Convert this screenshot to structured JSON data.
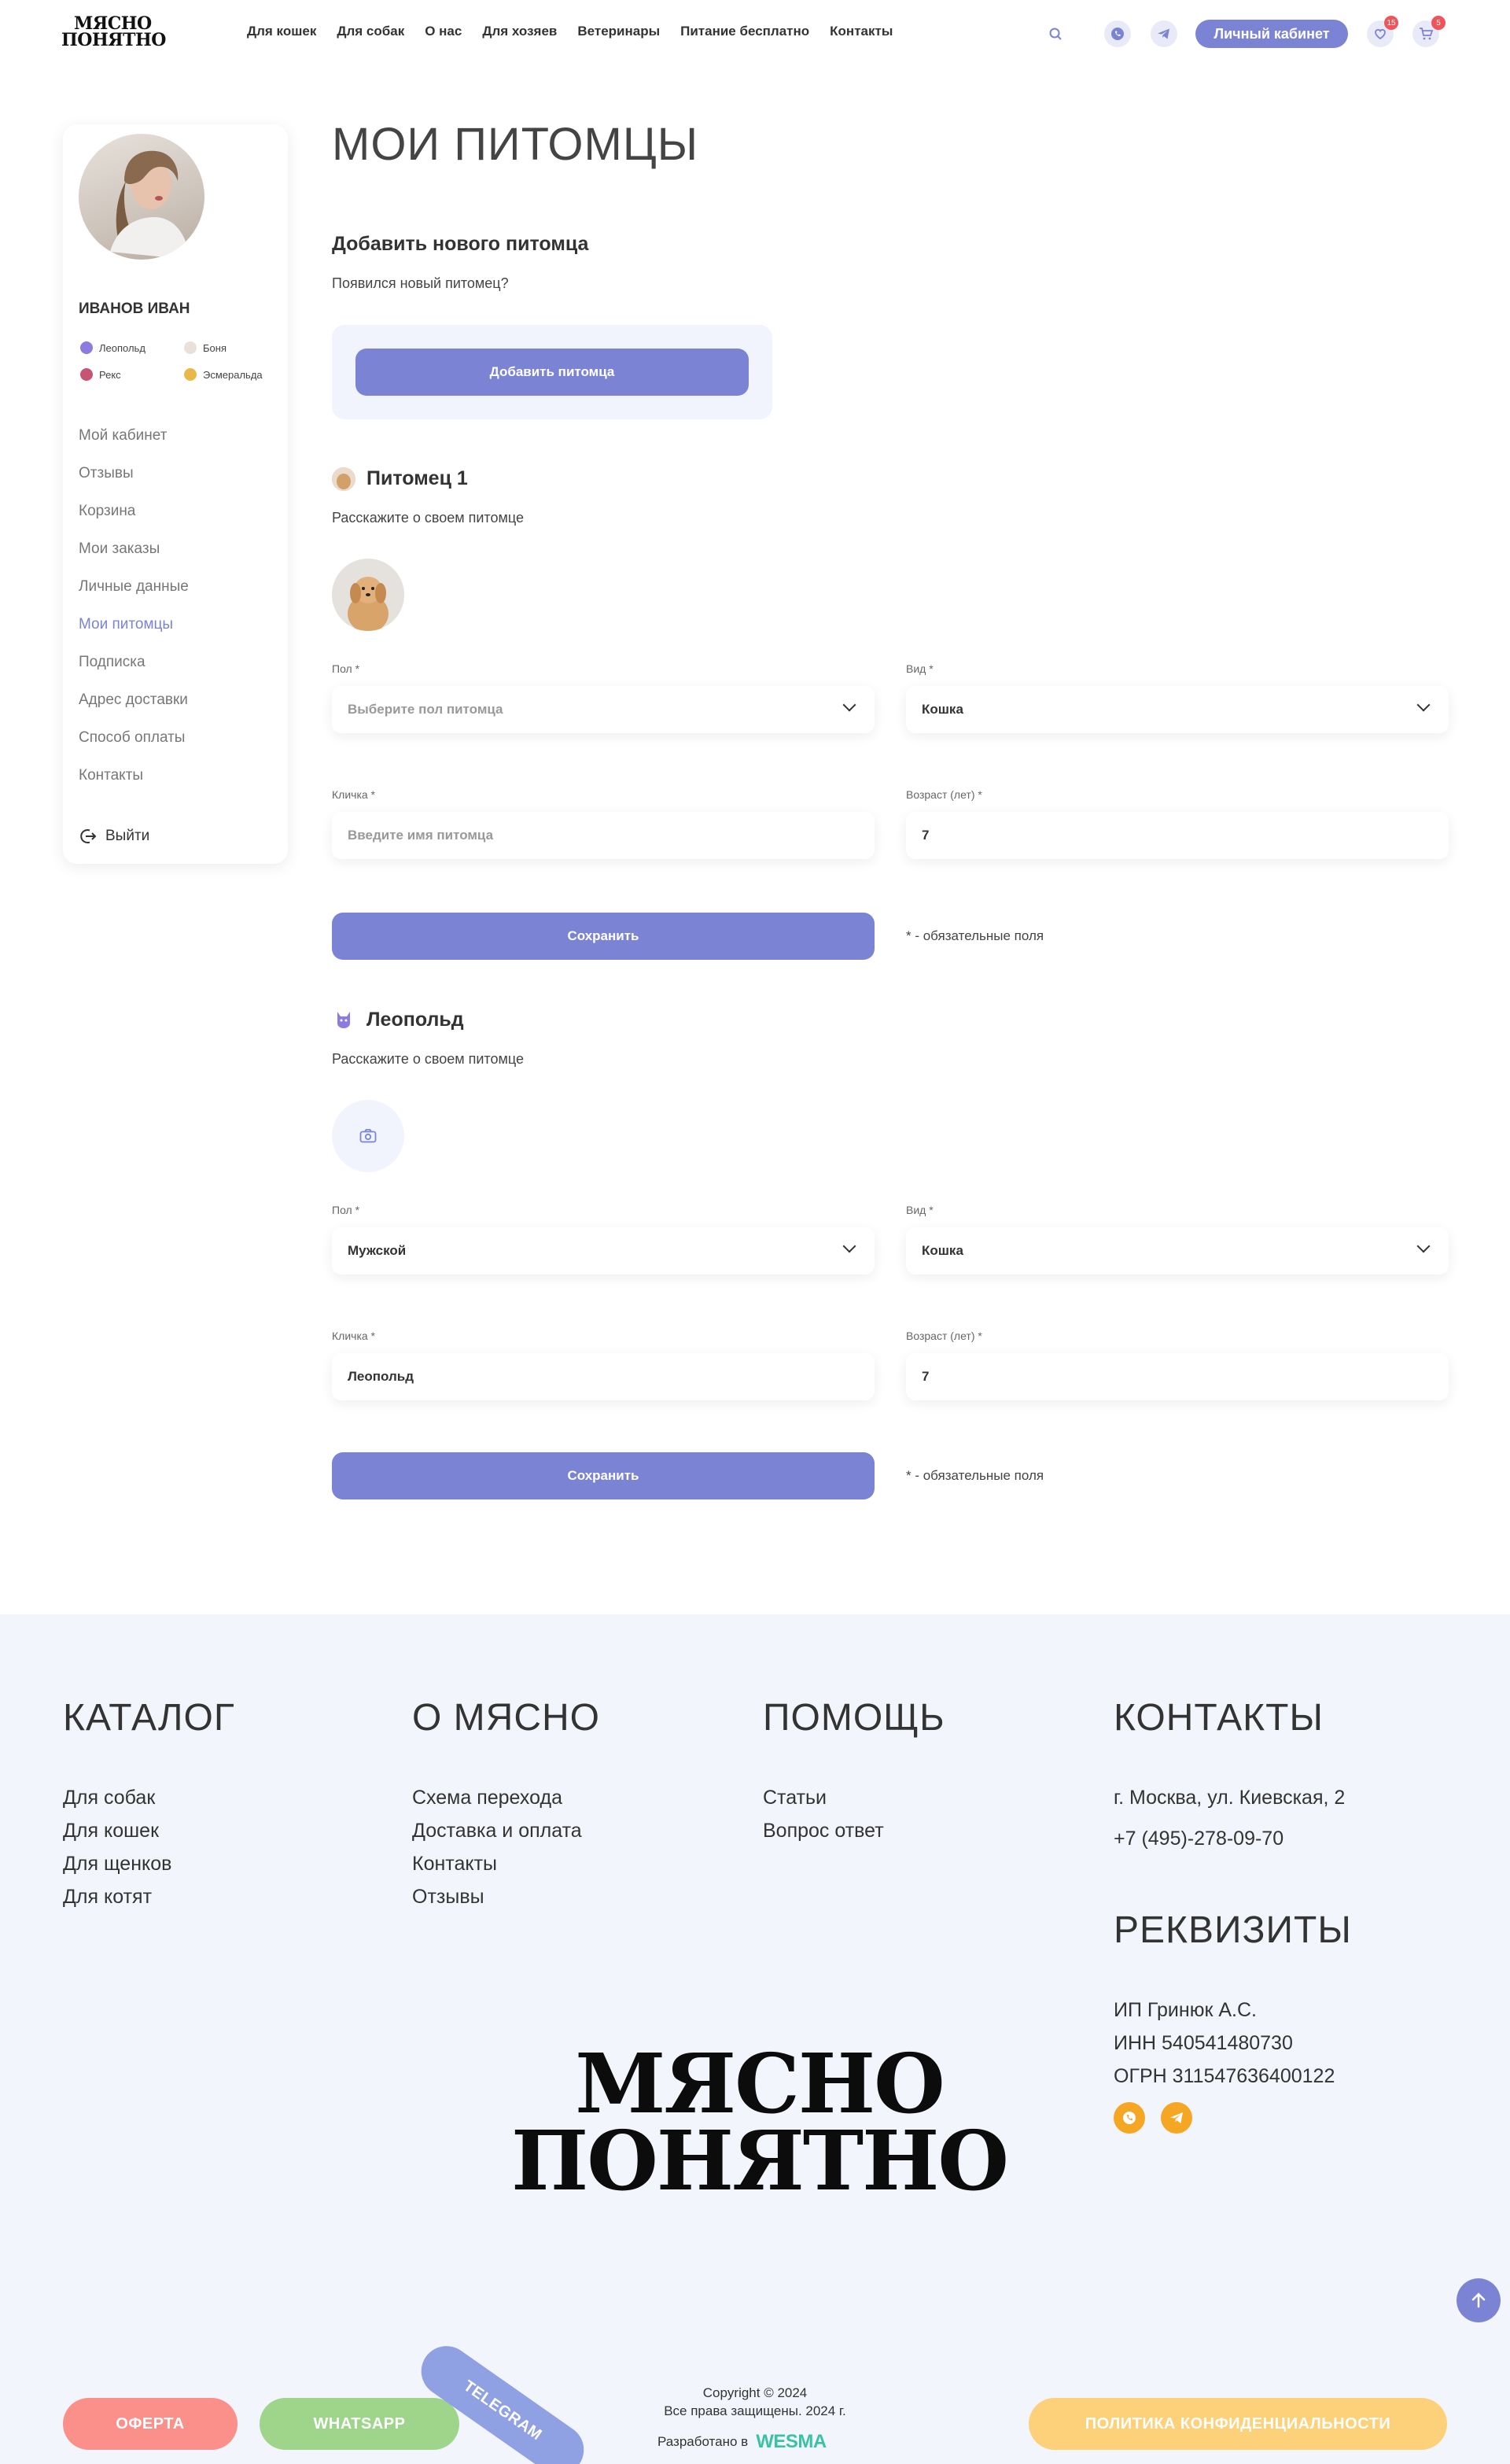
{
  "header": {
    "logo_line1": "МЯСНО",
    "logo_line2": "ПОНЯТНО",
    "nav": [
      "Для кошек",
      "Для собак",
      "О нас",
      "Для хозяев",
      "Ветеринары",
      "Питание бесплатно",
      "Контакты"
    ],
    "cabinet_label": "Личный кабинет",
    "favorites_count": "15",
    "cart_count": "5"
  },
  "sidebar": {
    "user_name": "ИВАНОВ ИВАН",
    "pets": [
      "Леопольд",
      "Боня",
      "Рекс",
      "Эсмеральда"
    ],
    "menu": [
      "Мой кабинет",
      "Отзывы",
      "Корзина",
      "Мои заказы",
      "Личные данные",
      "Мои питомцы",
      "Подписка",
      "Адрес доставки",
      "Способ оплаты",
      "Контакты"
    ],
    "active_item": "Мои питомцы",
    "logout": "Выйти"
  },
  "main": {
    "title": "МОИ ПИТОМЦЫ",
    "add_section": {
      "heading": "Добавить нового питомца",
      "subtitle": "Появился новый питомец?",
      "button": "Добавить питомца"
    },
    "pets": [
      {
        "heading": "Питомец 1",
        "subtitle": "Расскажите о своем питомце",
        "gender_label": "Пол *",
        "gender_value": "",
        "gender_placeholder": "Выберите пол питомца",
        "kind_label": "Вид *",
        "kind_value": "Кошка",
        "name_label": "Кличка *",
        "name_value": "",
        "name_placeholder": "Введите имя питомца",
        "age_label": "Возраст (лет) *",
        "age_value": "7",
        "save": "Сохранить",
        "required_note": "* - обязательные поля"
      },
      {
        "heading": "Леопольд",
        "subtitle": "Расскажите о своем питомце",
        "gender_label": "Пол *",
        "gender_value": "Мужской",
        "kind_label": "Вид *",
        "kind_value": "Кошка",
        "name_label": "Кличка *",
        "name_value": "Леопольд",
        "age_label": "Возраст (лет) *",
        "age_value": "7",
        "save": "Сохранить",
        "required_note": "* - обязательные поля"
      }
    ]
  },
  "footer": {
    "catalog": {
      "title": "КАТАЛОГ",
      "links": [
        "Для собак",
        "Для кошек",
        "Для щенков",
        "Для котят"
      ]
    },
    "about": {
      "title": "О МЯСНО",
      "links": [
        "Схема перехода",
        "Доставка и оплата",
        "Контакты",
        "Отзывы"
      ]
    },
    "help": {
      "title": "ПОМОЩЬ",
      "links": [
        "Статьи",
        "Вопрос ответ"
      ]
    },
    "contacts": {
      "title": "КОНТАКТЫ",
      "address": "г. Москва, ул. Киевская, 2",
      "phone": "+7 (495)-278-09-70"
    },
    "requisites": {
      "title": "РЕКВИЗИТЫ",
      "lines": [
        "ИП Гринюк А.С.",
        "ИНН 540541480730",
        "ОГРН 311547636400122"
      ]
    },
    "big_logo_line1": "МЯСНО",
    "big_logo_line2": "ПОНЯТНО",
    "pills": {
      "offer": "ОФЕРТА",
      "whatsapp": "WHATSAPP",
      "telegram": "TELEGRAM",
      "privacy": "ПОЛИТИКА КОНФИДЕНЦИАЛЬНОСТИ"
    },
    "copyright_line1": "Copyright © 2024",
    "copyright_line2": "Все права защищены. 2024 г.",
    "developed_by": "Разработано в",
    "developer": "WESMA",
    "colors": {
      "accent": "#7b84d4",
      "offer": "#fb8f8a",
      "whatsapp": "#9ed58a",
      "telegram": "#8fa0e3",
      "privacy": "#fdd07a",
      "social": "#f5a623"
    }
  }
}
